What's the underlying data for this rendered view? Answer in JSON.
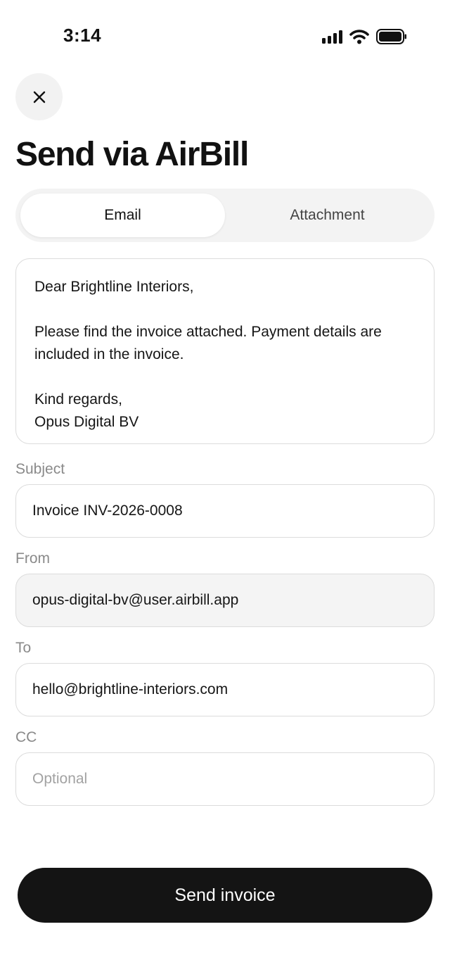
{
  "status_bar": {
    "time": "3:14"
  },
  "header": {
    "title": "Send via AirBill"
  },
  "tabs": [
    {
      "label": "Email",
      "active": true
    },
    {
      "label": "Attachment",
      "active": false
    }
  ],
  "message": {
    "greeting": "Dear Brightline Interiors,",
    "body": "Please find the invoice attached. Payment details are included in the invoice.",
    "closing": "Kind regards,",
    "signature": "Opus Digital BV"
  },
  "subject": {
    "label": "Subject",
    "value": "Invoice INV-2026-0008"
  },
  "from": {
    "label": "From",
    "value": "opus-digital-bv@user.airbill.app"
  },
  "to": {
    "label": "To",
    "value": "hello@brightline-interiors.com"
  },
  "cc": {
    "label": "CC",
    "placeholder": "Optional"
  },
  "actions": {
    "send_label": "Send invoice"
  },
  "icons": {
    "close": "close-icon",
    "signal": "cellular-signal-icon",
    "wifi": "wifi-icon",
    "battery": "battery-icon"
  },
  "colors": {
    "primary_button": "#141414",
    "accent_bg": "#f3f3f3"
  }
}
